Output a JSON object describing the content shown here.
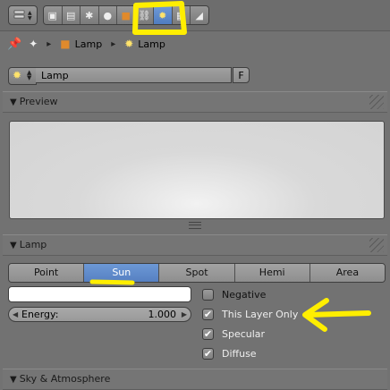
{
  "breadcrumb": {
    "items": [
      "Lamp",
      "Lamp"
    ]
  },
  "datablock": {
    "name": "Lamp",
    "fake_user": "F"
  },
  "panels": {
    "preview": {
      "title": "Preview"
    },
    "lamp": {
      "title": "Lamp"
    },
    "sky": {
      "title": "Sky & Atmosphere"
    }
  },
  "lamp_types": [
    "Point",
    "Sun",
    "Spot",
    "Hemi",
    "Area"
  ],
  "lamp_active": "Sun",
  "energy": {
    "label": "Energy:",
    "value": "1.000"
  },
  "checkboxes": [
    {
      "label": "Negative",
      "checked": false
    },
    {
      "label": "This Layer Only",
      "checked": true
    },
    {
      "label": "Specular",
      "checked": true
    },
    {
      "label": "Diffuse",
      "checked": true
    }
  ],
  "colors": {
    "annotation": "#ffee00",
    "active": "#5680c2"
  }
}
